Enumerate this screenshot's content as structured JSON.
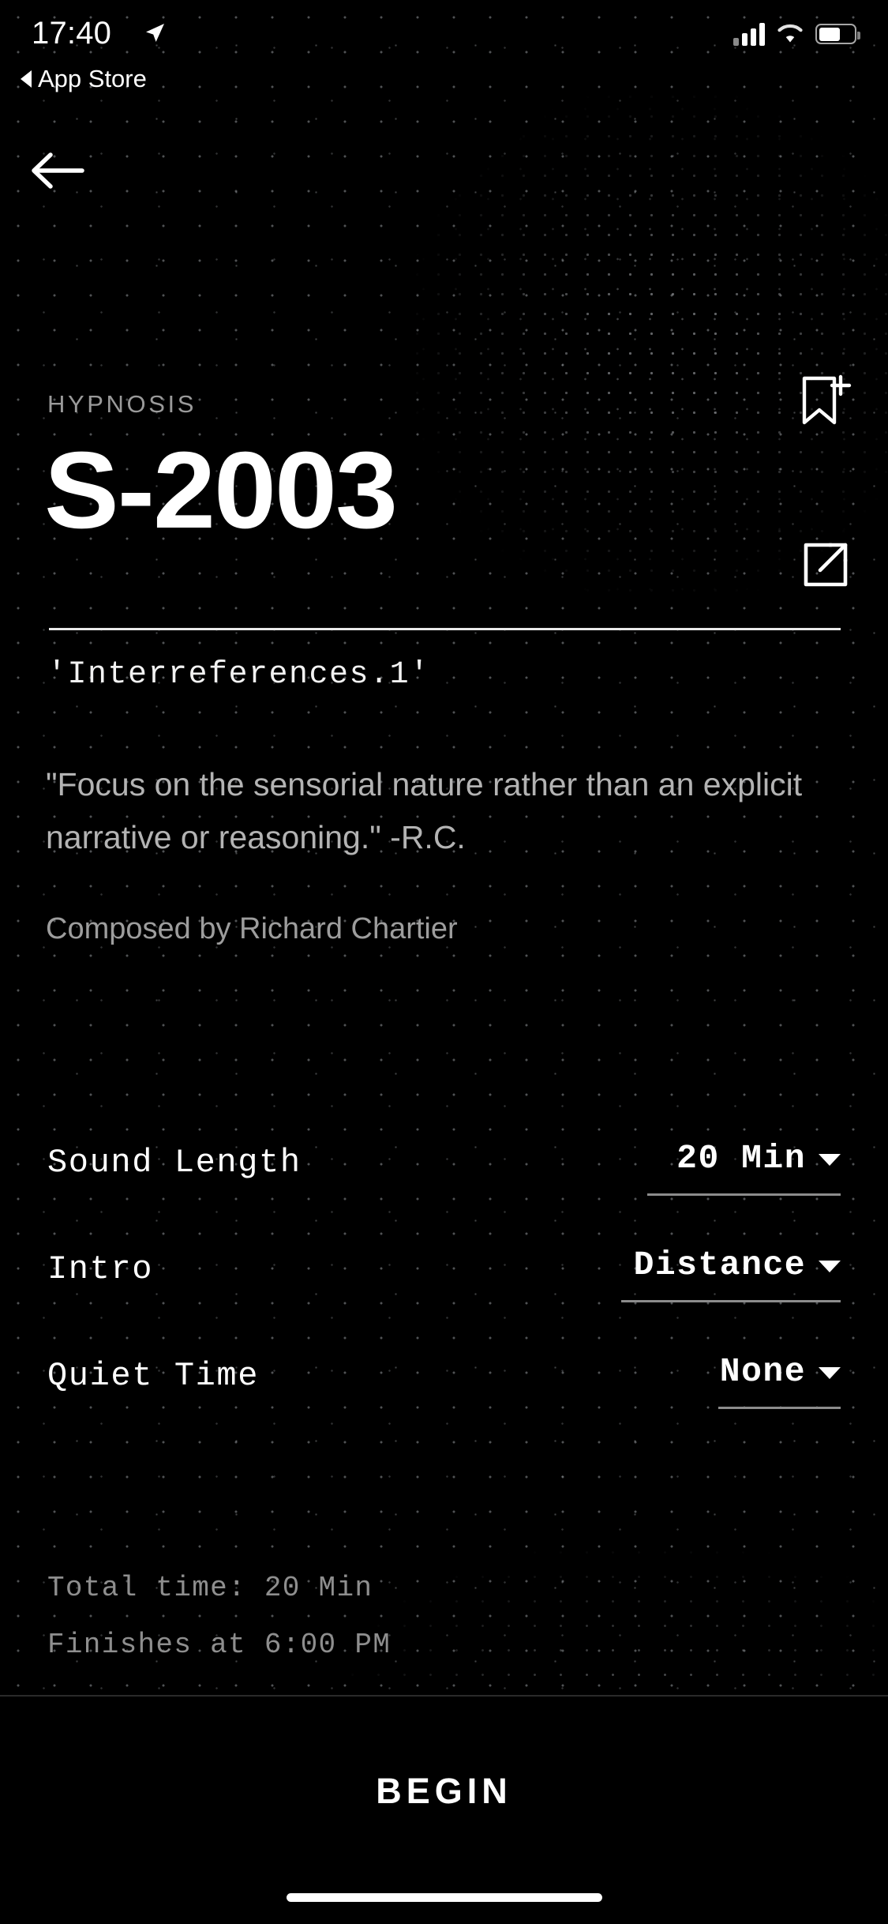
{
  "status_bar": {
    "time": "17:40",
    "location_icon": "location-arrow-icon",
    "back_app_label": "App Store",
    "signal_icon": "cellular-signal-icon",
    "wifi_icon": "wifi-icon",
    "battery_icon": "battery-icon"
  },
  "nav": {
    "back_icon": "arrow-left-icon"
  },
  "header": {
    "kicker": "HYPNOSIS",
    "title": "S-2003",
    "subtitle": "'Interreferences.1'",
    "quote": "\"Focus on the sensorial nature rather than an explicit narrative or reasoning.\"  -R.C.",
    "composer": "Composed by Richard Chartier",
    "bookmark_icon": "bookmark-add-icon",
    "share_icon": "external-link-icon"
  },
  "options": [
    {
      "label": "Sound Length",
      "value": "20 Min",
      "caret_icon": "chevron-down-icon"
    },
    {
      "label": "Intro",
      "value": "Distance",
      "caret_icon": "chevron-down-icon"
    },
    {
      "label": "Quiet Time",
      "value": "None",
      "caret_icon": "chevron-down-icon"
    }
  ],
  "summary": {
    "total_time": "Total time: 20 Min",
    "finishes_at": "Finishes at 6:00 PM"
  },
  "footer": {
    "begin_label": "BEGIN"
  },
  "colors": {
    "background": "#000000",
    "text_primary": "#ffffff",
    "text_muted": "#9a9a9a",
    "rule": "#e9e9e9",
    "underline": "#8c8c8c"
  }
}
